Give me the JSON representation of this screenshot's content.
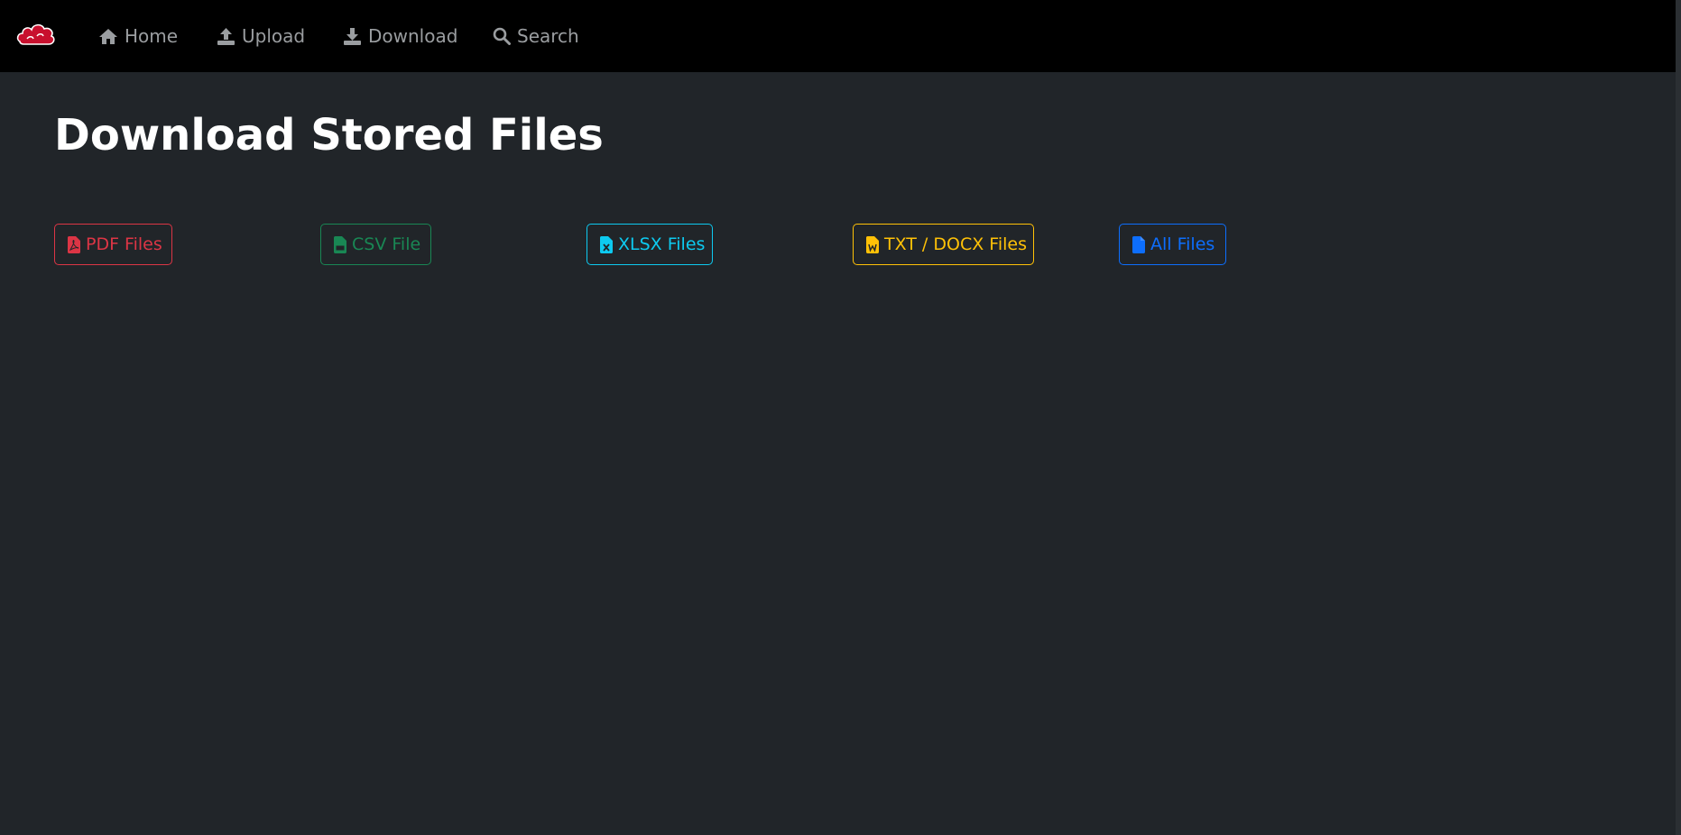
{
  "nav": {
    "items": [
      {
        "label": "Home",
        "icon": "home-icon"
      },
      {
        "label": "Upload",
        "icon": "upload-icon"
      },
      {
        "label": "Download",
        "icon": "download-icon"
      },
      {
        "label": "Search",
        "icon": "search-icon"
      }
    ]
  },
  "page": {
    "title": "Download Stored Files"
  },
  "buttons": [
    {
      "label": "PDF Files",
      "icon": "pdf-file-icon",
      "color": "#dc3545"
    },
    {
      "label": "CSV File",
      "icon": "csv-file-icon",
      "color": "#198754"
    },
    {
      "label": "XLSX Files",
      "icon": "xlsx-file-icon",
      "color": "#0dcaf0"
    },
    {
      "label": "TXT / DOCX Files",
      "icon": "docx-file-icon",
      "color": "#ffc107"
    },
    {
      "label": "All Files",
      "icon": "file-icon",
      "color": "#0d6efd"
    }
  ],
  "colors": {
    "navbar_bg": "#000000",
    "page_bg": "#212529",
    "nav_text": "#9a9da0",
    "brand_red": "#c8102e"
  }
}
